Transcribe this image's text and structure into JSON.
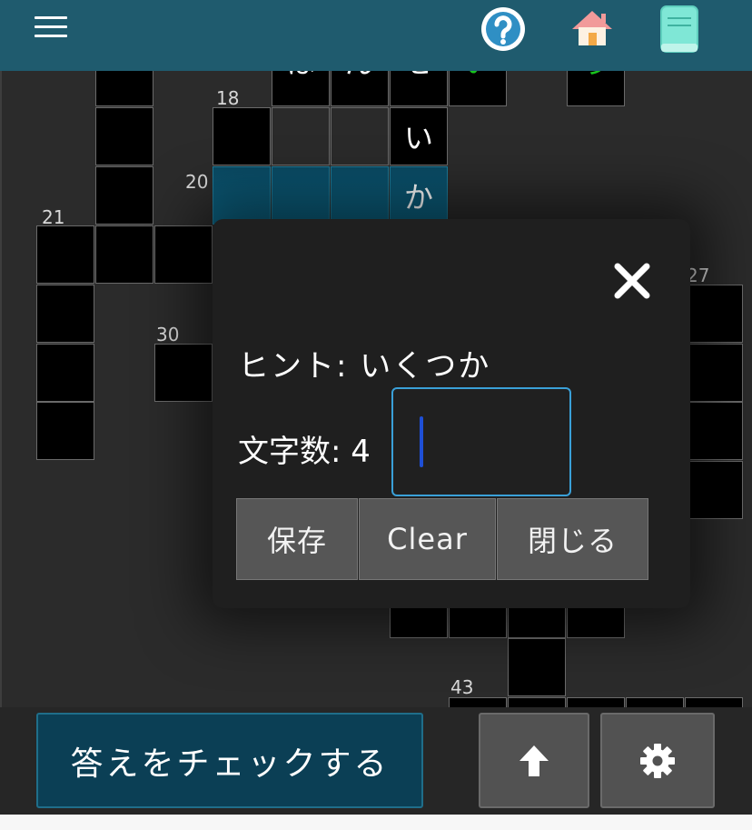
{
  "header": {
    "menu_icon": "hamburger-icon",
    "help_icon": "question-icon",
    "home_icon": "house-icon",
    "book_icon": "book-icon"
  },
  "board": {
    "clue_numbers": [
      "18",
      "20",
      "21",
      "27",
      "30",
      "43"
    ],
    "letters": [
      "は",
      "ん",
      "せ",
      "い",
      "う",
      "い",
      "か"
    ]
  },
  "modal": {
    "hint_label": "ヒント: いくつか",
    "count_label": "文字数: 4",
    "input_value": "",
    "buttons": {
      "save": "保存",
      "clear": "Clear",
      "close": "閉じる"
    }
  },
  "footer": {
    "check_label": "答えをチェックする",
    "up_icon": "arrow-up-icon",
    "settings_icon": "gear-icon"
  },
  "colors": {
    "header": "#1f5b6e",
    "board_bg": "#2b2b2b",
    "selected_cell": "#0c6585",
    "green_letter": "#19c41d",
    "check_button": "#0b3f55",
    "input_border": "#3aa0d8"
  }
}
